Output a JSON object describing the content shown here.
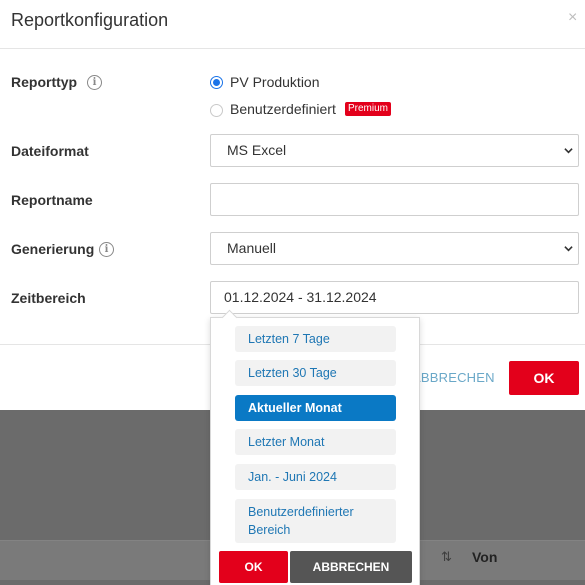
{
  "modal": {
    "title": "Reportkonfiguration",
    "close_glyph": "×",
    "ok_label": "OK",
    "cancel_label": "ABBRECHEN"
  },
  "form": {
    "reporttyp": {
      "label": "Reporttyp",
      "options": [
        {
          "label": "PV Produktion",
          "selected": true
        },
        {
          "label": "Benutzerdefiniert",
          "selected": false,
          "badge": "Premium"
        }
      ]
    },
    "dateiformat": {
      "label": "Dateiformat",
      "value": "MS Excel"
    },
    "reportname": {
      "label": "Reportname",
      "value": ""
    },
    "generierung": {
      "label": "Generierung",
      "value": "Manuell"
    },
    "zeitbereich": {
      "label": "Zeitbereich",
      "value": "01.12.2024 - 31.12.2024"
    }
  },
  "date_dropdown": {
    "presets": [
      {
        "label": "Letzten 7 Tage",
        "active": false
      },
      {
        "label": "Letzten 30 Tage",
        "active": false
      },
      {
        "label": "Aktueller Monat",
        "active": true
      },
      {
        "label": "Letzter Monat",
        "active": false
      },
      {
        "label": "Jan. - Juni 2024",
        "active": false
      },
      {
        "label": "Benutzerdefinierter Bereich",
        "active": false
      }
    ],
    "ok_label": "OK",
    "cancel_label": "ABBRECHEN"
  },
  "background": {
    "column_header": "Von",
    "sort_glyph": "⇅"
  },
  "colors": {
    "accent_red": "#e3001b",
    "active_blue": "#0a79c5",
    "link_blue": "#1f77b4"
  },
  "icons": {
    "info": "info-icon",
    "chevron": "chevron-down-icon",
    "close": "close-icon",
    "sort": "sort-icon"
  }
}
